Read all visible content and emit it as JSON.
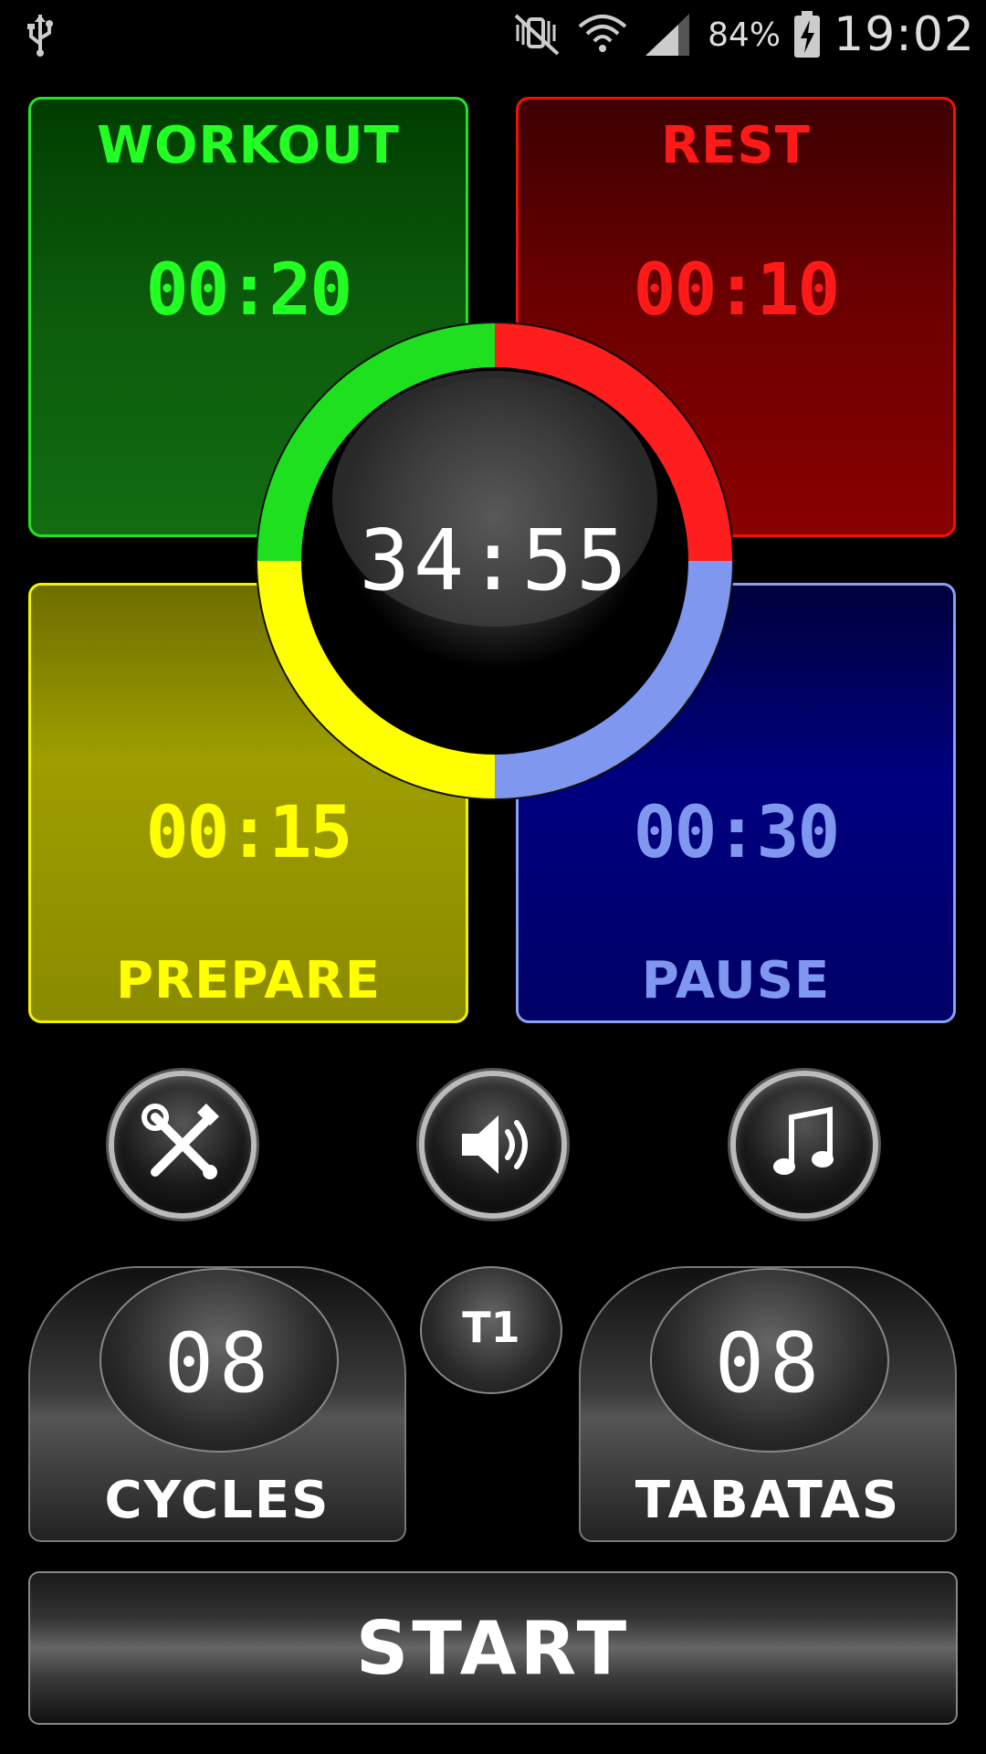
{
  "status_bar": {
    "battery_percent": "84%",
    "time": "19:02",
    "icons": [
      "usb-icon",
      "mute-vibrate-icon",
      "wifi-icon",
      "signal-icon",
      "battery-charging-icon"
    ]
  },
  "panels": {
    "workout": {
      "label": "WORKOUT",
      "time": "00:20",
      "color": "#22ff22"
    },
    "rest": {
      "label": "REST",
      "time": "00:10",
      "color": "#ff1a1a"
    },
    "prepare": {
      "label": "PREPARE",
      "time": "00:15",
      "color": "#ffff00"
    },
    "pause": {
      "label": "PAUSE",
      "time": "00:30",
      "color": "#7f97ee"
    }
  },
  "main_timer": {
    "time": "34:55"
  },
  "toolbar": {
    "icons": [
      "settings-tools-icon",
      "sound-icon",
      "music-note-icon"
    ]
  },
  "counters": {
    "cycles": {
      "value": "08",
      "label": "CYCLES"
    },
    "tabatas": {
      "value": "08",
      "label": "TABATAS"
    }
  },
  "preset": {
    "label": "T1"
  },
  "start": {
    "label": "START"
  }
}
